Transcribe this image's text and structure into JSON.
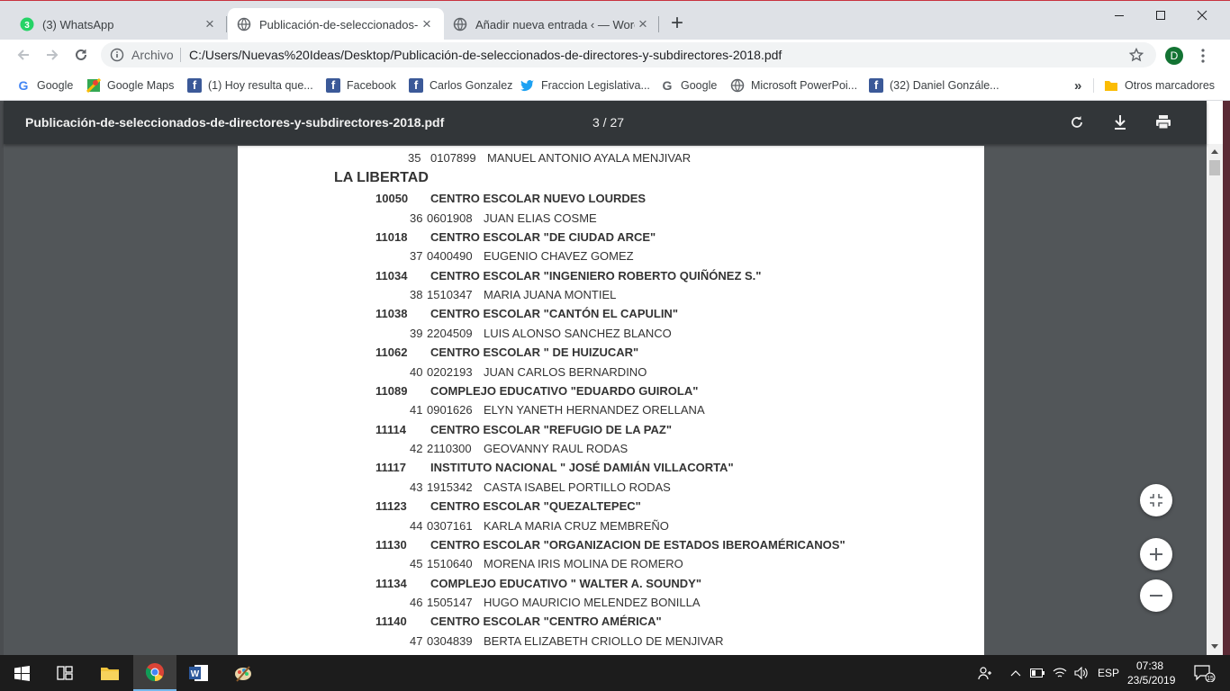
{
  "browser": {
    "tabs": [
      {
        "label": "(3) WhatsApp",
        "icon": "whatsapp-icon",
        "badge": "3"
      },
      {
        "label": "Publicación-de-seleccionados-de",
        "icon": "globe-icon"
      },
      {
        "label": "Añadir nueva entrada ‹ — WordP",
        "icon": "globe-icon"
      }
    ],
    "omnibox": {
      "scheme": "Archivo",
      "url": "C:/Users/Nuevas%20Ideas/Desktop/Publicación-de-seleccionados-de-directores-y-subdirectores-2018.pdf"
    },
    "profile_initial": "D"
  },
  "bookmarks": [
    {
      "label": "Google",
      "icon": "google-icon"
    },
    {
      "label": "Google Maps",
      "icon": "maps-icon"
    },
    {
      "label": "(1) Hoy resulta que...",
      "icon": "facebook-icon"
    },
    {
      "label": "Facebook",
      "icon": "facebook-icon"
    },
    {
      "label": "Carlos Gonzalez",
      "icon": "facebook-icon"
    },
    {
      "label": "Fraccion Legislativa...",
      "icon": "twitter-icon"
    },
    {
      "label": "Google",
      "icon": "google-icon"
    },
    {
      "label": "Microsoft PowerPoi...",
      "icon": "globe-icon"
    },
    {
      "label": "(32) Daniel Gonzále...",
      "icon": "facebook-icon"
    }
  ],
  "bookmarks_overflow": "»",
  "other_bookmarks": "Otros marcadores",
  "pdf": {
    "title": "Publicación-de-seleccionados-de-directores-y-subdirectores-2018.pdf",
    "page": "3 / 27",
    "prev_line": {
      "num": "35",
      "code": "0107899",
      "name": "MANUEL ANTONIO AYALA MENJIVAR"
    },
    "region": "LA LIBERTAD",
    "entries": [
      {
        "code": "10050",
        "school": "CENTRO ESCOLAR NUEVO LOURDES",
        "num": "36",
        "id": "0601908",
        "name": "JUAN ELIAS COSME"
      },
      {
        "code": "11018",
        "school": "CENTRO ESCOLAR \"DE CIUDAD ARCE\"",
        "num": "37",
        "id": "0400490",
        "name": "EUGENIO CHAVEZ GOMEZ"
      },
      {
        "code": "11034",
        "school": "CENTRO ESCOLAR \"INGENIERO ROBERTO QUIÑÓNEZ S.\"",
        "num": "38",
        "id": "1510347",
        "name": "MARIA JUANA MONTIEL"
      },
      {
        "code": "11038",
        "school": "CENTRO ESCOLAR \"CANTÓN EL CAPULIN\"",
        "num": "39",
        "id": "2204509",
        "name": "LUIS ALONSO SANCHEZ BLANCO"
      },
      {
        "code": "11062",
        "school": "CENTRO ESCOLAR \" DE HUIZUCAR\"",
        "num": "40",
        "id": "0202193",
        "name": "JUAN CARLOS BERNARDINO"
      },
      {
        "code": "11089",
        "school": "COMPLEJO  EDUCATIVO \"EDUARDO GUIROLA\"",
        "num": "41",
        "id": "0901626",
        "name": "ELYN YANETH HERNANDEZ ORELLANA"
      },
      {
        "code": "11114",
        "school": "CENTRO ESCOLAR \"REFUGIO DE LA PAZ\"",
        "num": "42",
        "id": "2110300",
        "name": "GEOVANNY RAUL RODAS"
      },
      {
        "code": "11117",
        "school": "INSTITUTO NACIONAL \" JOSÉ DAMIÁN VILLACORTA\"",
        "num": "43",
        "id": "1915342",
        "name": "CASTA ISABEL PORTILLO RODAS"
      },
      {
        "code": "11123",
        "school": "CENTRO ESCOLAR \"QUEZALTEPEC\"",
        "num": "44",
        "id": "0307161",
        "name": "KARLA MARIA CRUZ MEMBREÑO"
      },
      {
        "code": "11130",
        "school": "CENTRO ESCOLAR \"ORGANIZACION DE ESTADOS IBEROAMÉRICANOS\"",
        "num": "45",
        "id": "1510640",
        "name": "MORENA IRIS MOLINA DE ROMERO"
      },
      {
        "code": "11134",
        "school": "COMPLEJO EDUCATIVO \" WALTER A. SOUNDY\"",
        "num": "46",
        "id": "1505147",
        "name": "HUGO MAURICIO MELENDEZ BONILLA"
      },
      {
        "code": "11140",
        "school": "CENTRO ESCOLAR \"CENTRO AMÉRICA\"",
        "num": "47",
        "id": "0304839",
        "name": "BERTA ELIZABETH CRIOLLO DE MENJIVAR"
      }
    ]
  },
  "taskbar": {
    "apps": [
      "windows-start-icon",
      "task-view-icon",
      "file-explorer-icon",
      "chrome-icon",
      "word-icon",
      "paint-icon"
    ],
    "language": "ESP",
    "time": "07:38",
    "date": "23/5/2019",
    "notifications": "15"
  },
  "colors": {
    "pdf_toolbar": "#323639",
    "pdf_background": "#525659",
    "tabstrip": "#dee1e6",
    "taskbar": "#1c1c1c"
  }
}
